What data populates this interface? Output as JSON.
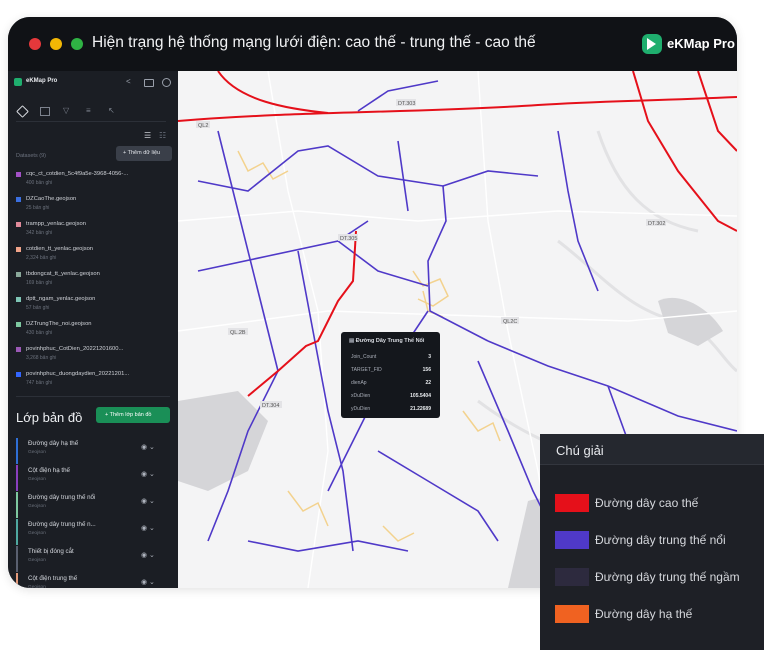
{
  "title": "Hiện trạng hệ thống mạng lưới điện: cao thế - trung thế - cao thế",
  "brand": "eKMap Pro",
  "colors": {
    "red_dot": "#e5383b",
    "yellow_dot": "#f2b705",
    "green_dot": "#2fb344",
    "accent": "#1fae6e"
  },
  "sidebar": {
    "app_name": "eKMap Pro",
    "datasets_label": "Datasets (9)",
    "add_data_label": "+ Thêm dữ liệu",
    "datasets": [
      {
        "name": "cqc_ct_cotdien_5c4f9a5e-3968-4056-...",
        "count": "400 bản ghi",
        "color": "#a351c7"
      },
      {
        "name": "DZCaoThe.geojson",
        "count": "25 bản ghi",
        "color": "#3b6fe0"
      },
      {
        "name": "trampp_yenlac.geojson",
        "count": "342 bản ghi",
        "color": "#e08a9a"
      },
      {
        "name": "cotdien_tt_yenlac.geojson",
        "count": "2,324 bản ghi",
        "color": "#f1a48a"
      },
      {
        "name": "tbdongcat_tt_yenlac.geojson",
        "count": "169 bản ghi",
        "color": "#8aa89a"
      },
      {
        "name": "dptt_ngam_yenlac.geojson",
        "count": "57 bản ghi",
        "color": "#7fc6b6"
      },
      {
        "name": "DZTrungThe_noi.geojson",
        "count": "430 bản ghi",
        "color": "#7ec8a0"
      },
      {
        "name": "povinhphuc_CotDien_20221201600...",
        "count": "3,268 bản ghi",
        "color": "#9b59b6"
      },
      {
        "name": "povinhphuc_duongdaydien_20221201...",
        "count": "747 bản ghi",
        "color": "#3366ff"
      }
    ],
    "layers_title": "Lớp bản đồ",
    "add_layer_label": "+ Thêm lớp bản đồ",
    "layers": [
      {
        "name": "Đường dây hạ thế",
        "type": "Geojson",
        "color": "#2f6fd6"
      },
      {
        "name": "Cột điện hạ thế",
        "type": "Geojson",
        "color": "#8a3fc0"
      },
      {
        "name": "Đường dây trung thế nổi",
        "type": "Geojson",
        "color": "#7ec8a0"
      },
      {
        "name": "Đường dây trung thế n...",
        "type": "Geojson",
        "color": "#4fa8a0"
      },
      {
        "name": "Thiết bị đóng cắt",
        "type": "Geojson",
        "color": "#5a6070"
      },
      {
        "name": "Cột điện trung thế",
        "type": "Geojson",
        "color": "#e39a7b"
      }
    ]
  },
  "popup": {
    "title": "Đường Dây Trung Thế Nổi",
    "rows": [
      {
        "key": "Join_Count",
        "value": "3"
      },
      {
        "key": "TARGET_FID",
        "value": "156"
      },
      {
        "key": "dienAp",
        "value": "22"
      },
      {
        "key": "xDuDien",
        "value": "105.5404"
      },
      {
        "key": "yDuDien",
        "value": "21.22689"
      }
    ]
  },
  "map": {
    "road_labels": [
      "QL2",
      "QL2C",
      "DT.303",
      "DT.304",
      "DT.302",
      "QL.2B",
      "DT.305"
    ]
  },
  "legend": {
    "title": "Chú giải",
    "items": [
      {
        "label": "Đường dây cao thế",
        "color": "#e5101a"
      },
      {
        "label": "Đường dây trung thế nổi",
        "color": "#4f39c8"
      },
      {
        "label": "Đường dây trung thế ngầm",
        "color": "#2d2a3e"
      },
      {
        "label": "Đường dây hạ thế",
        "color": "#f06221"
      }
    ]
  }
}
